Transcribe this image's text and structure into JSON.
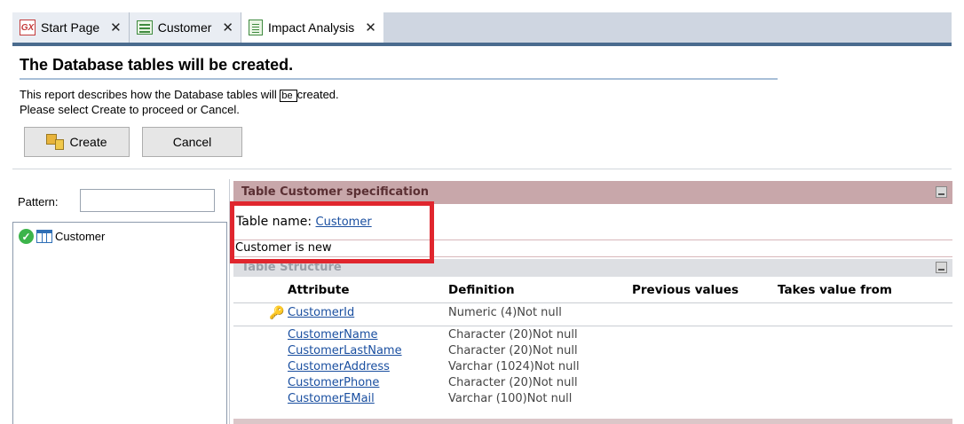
{
  "tabs": [
    {
      "label": "Start Page",
      "icon": "gx-logo-icon"
    },
    {
      "label": "Customer",
      "icon": "transaction-grid-icon"
    },
    {
      "label": "Impact Analysis",
      "icon": "report-document-icon"
    }
  ],
  "tab_close_glyph": "✕",
  "report": {
    "title": "The Database tables will be created.",
    "desc_before": "This report describes how the Database tables will ",
    "desc_boxed": "be ",
    "desc_after": "created.",
    "desc_line2": "Please select Create to proceed or Cancel."
  },
  "buttons": {
    "create": "Create",
    "cancel": "Cancel"
  },
  "filter": {
    "label": "Pattern:",
    "value": ""
  },
  "tree": {
    "items": [
      {
        "label": "Customer",
        "status": "ok"
      }
    ]
  },
  "spec": {
    "header": "Table Customer specification",
    "table_name_label": "Table name:",
    "table_name_value": "Customer",
    "status_text": "Customer is new",
    "structure_header": "Table Structure",
    "columns": [
      "Attribute",
      "Definition",
      "Previous values",
      "Takes value from"
    ],
    "rows": [
      {
        "attribute": "CustomerId",
        "definition": "Numeric (4)Not null",
        "key": true
      },
      {
        "attribute": "CustomerName",
        "definition": "Character (20)Not null",
        "key": false
      },
      {
        "attribute": "CustomerLastName",
        "definition": "Character (20)Not null",
        "key": false
      },
      {
        "attribute": "CustomerAddress",
        "definition": "Varchar (1024)Not null",
        "key": false
      },
      {
        "attribute": "CustomerPhone",
        "definition": "Character (20)Not null",
        "key": false
      },
      {
        "attribute": "CustomerEMail",
        "definition": "Varchar (100)Not null",
        "key": false
      }
    ]
  },
  "colors": {
    "highlight": "#e0262e",
    "spec_header": "#c8a7aa",
    "link": "#1a4fa0"
  }
}
